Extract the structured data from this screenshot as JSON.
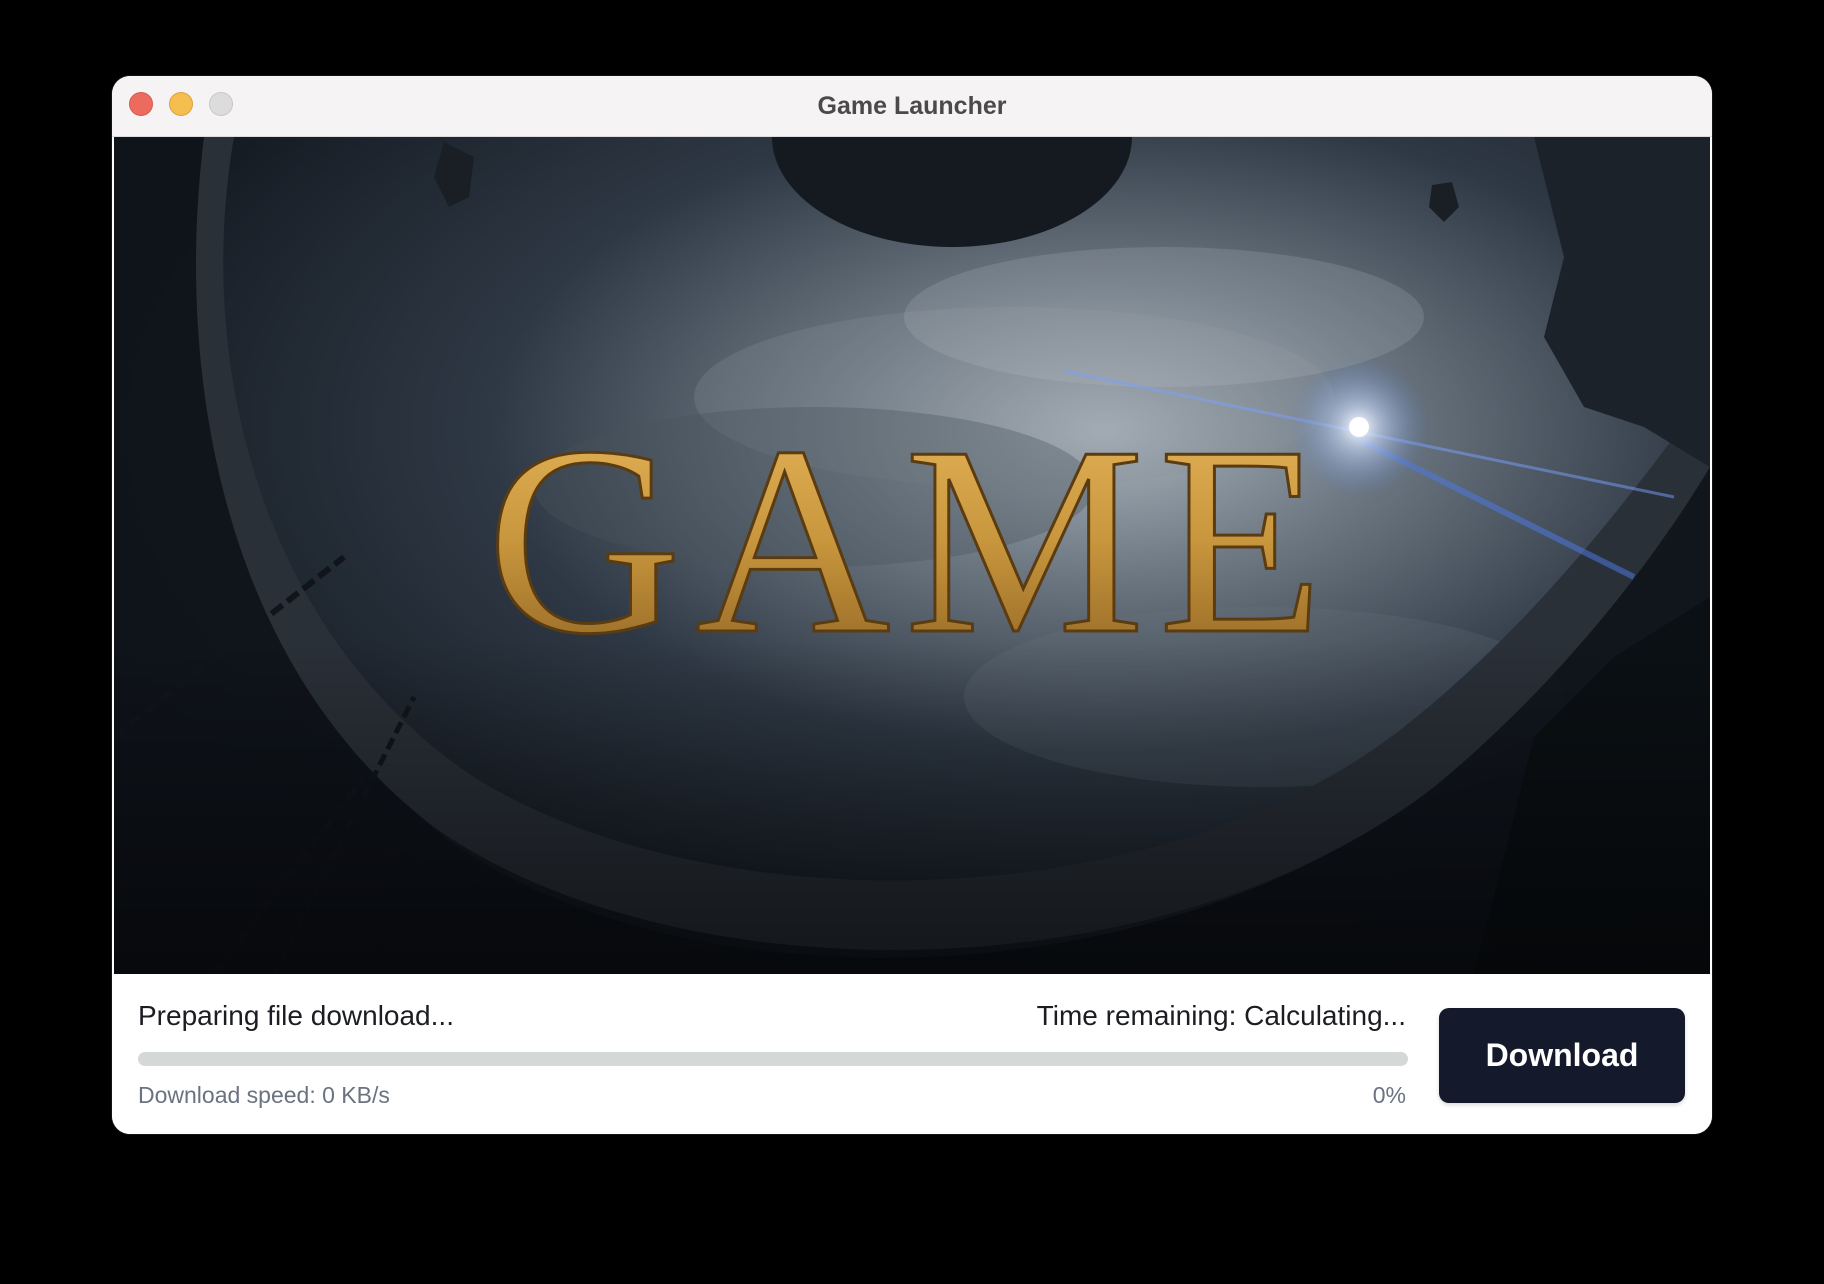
{
  "window": {
    "title": "Game Launcher"
  },
  "banner": {
    "logo_text": "GAME",
    "logo_color": "#c8963c"
  },
  "download": {
    "status": "Preparing file download...",
    "time_remaining": "Time remaining: Calculating...",
    "speed": "Download speed: 0 KB/s",
    "percent_label": "0%",
    "progress_fraction": 0,
    "button_label": "Download"
  },
  "colors": {
    "button_bg": "#141a2b",
    "progress_track": "#d4d8d7",
    "close": "#ed6a5e",
    "minimize": "#f5bf4f",
    "zoom": "#dcdcdc"
  }
}
